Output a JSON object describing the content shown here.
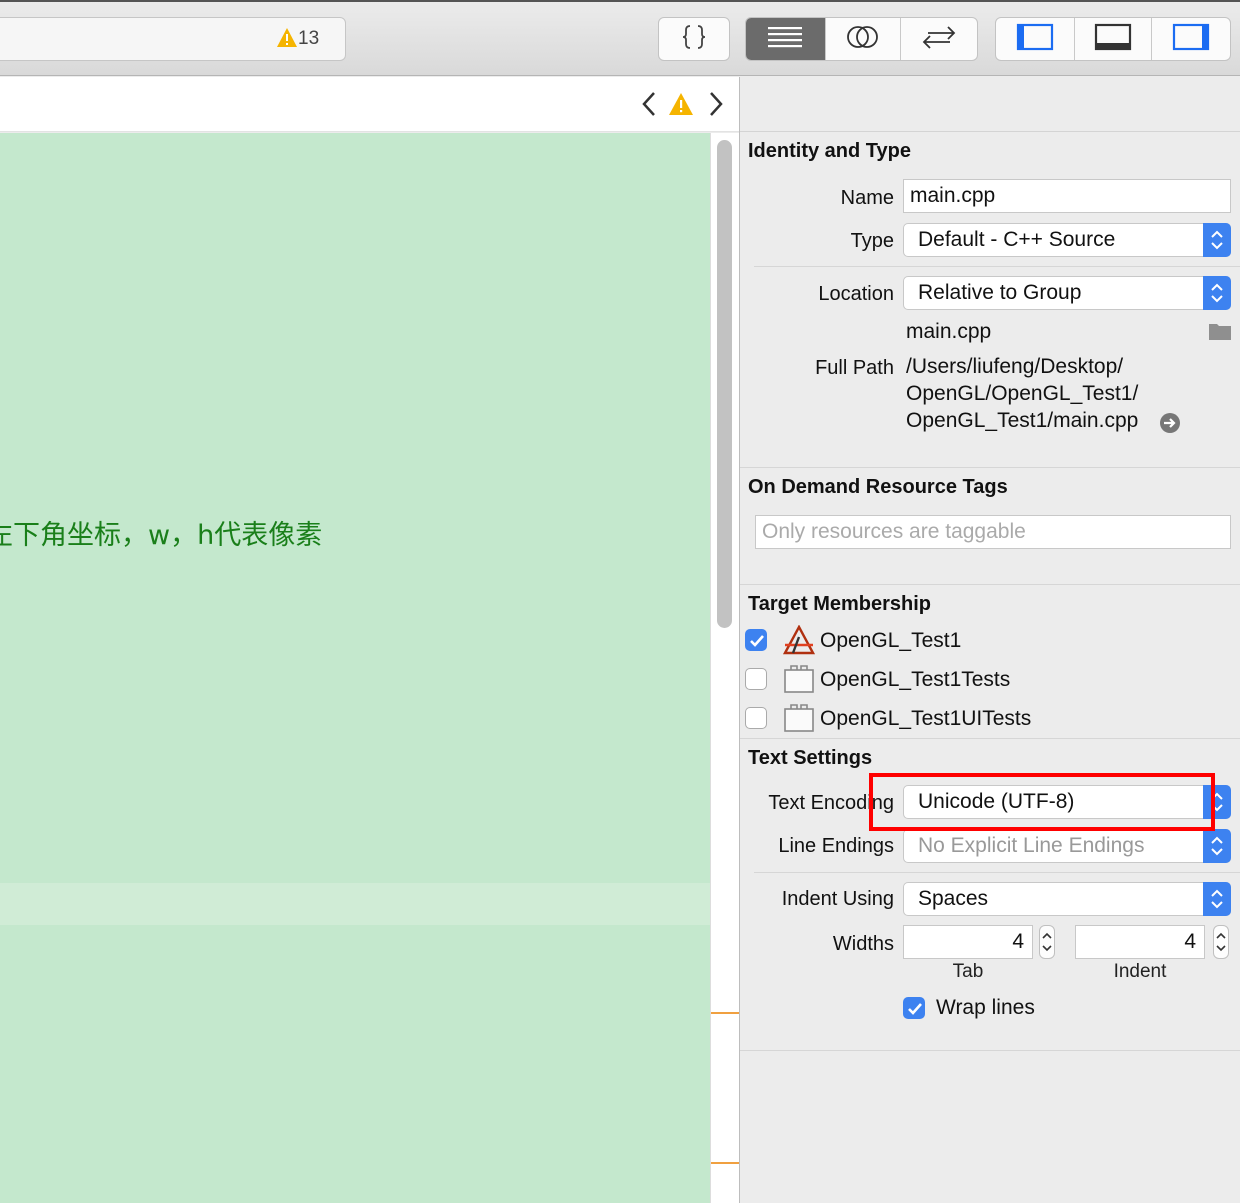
{
  "toolbar": {
    "warning_count": "13",
    "buttons": [
      "braces-button",
      "standard-editor-button",
      "assistant-editor-button",
      "version-editor-button",
      "navigator-toggle",
      "debug-area-toggle",
      "utilities-toggle"
    ]
  },
  "editor": {
    "comment_fragment": "左下角坐标，w，h代表像素"
  },
  "inspector": {
    "identity": {
      "title": "Identity and Type",
      "name_label": "Name",
      "name_value": "main.cpp",
      "type_label": "Type",
      "type_value": "Default - C++ Source",
      "location_label": "Location",
      "location_value": "Relative to Group",
      "file_name": "main.cpp",
      "full_path_label": "Full Path",
      "full_path_line1": "/Users/liufeng/Desktop/",
      "full_path_line2": "OpenGL/OpenGL_Test1/",
      "full_path_line3": "OpenGL_Test1/main.cpp"
    },
    "odr": {
      "title": "On Demand Resource Tags",
      "placeholder": "Only resources are taggable"
    },
    "target_membership": {
      "title": "Target Membership",
      "targets": [
        {
          "name": "OpenGL_Test1",
          "checked": true
        },
        {
          "name": "OpenGL_Test1Tests",
          "checked": false
        },
        {
          "name": "OpenGL_Test1UITests",
          "checked": false
        }
      ]
    },
    "text_settings": {
      "title": "Text Settings",
      "encoding_label": "Text Encoding",
      "encoding_value": "Unicode (UTF-8)",
      "line_endings_label": "Line Endings",
      "line_endings_value": "No Explicit Line Endings",
      "indent_using_label": "Indent Using",
      "indent_using_value": "Spaces",
      "widths_label": "Widths",
      "tab_width": "4",
      "indent_width": "4",
      "tab_label": "Tab",
      "indent_label": "Indent",
      "wrap_lines_label": "Wrap lines",
      "wrap_lines": true
    }
  },
  "colors": {
    "accent": "#3d82f0",
    "editor_bg": "#c4e8cd",
    "comment": "#1a7f1a",
    "highlight_box": "#ff0000",
    "warning": "#f5b400"
  }
}
